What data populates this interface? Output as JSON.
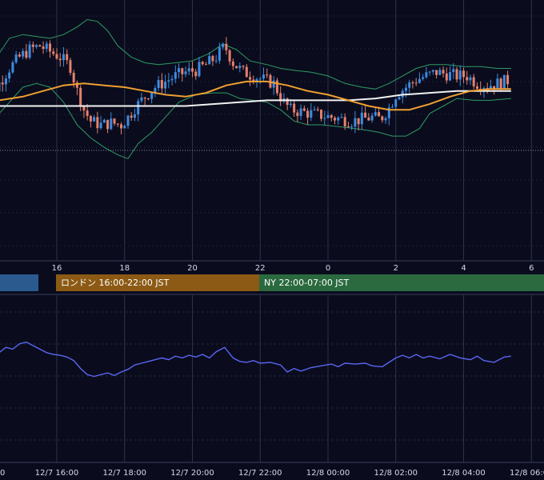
{
  "colors": {
    "background": "#0a0c1e",
    "grid": "#2e3248",
    "candle_up": "#3d8be0",
    "candle_down": "#e8806a",
    "bollinger": "#2f9b63",
    "ma_orange": "#f0a030",
    "ma_white": "#f2f2f2",
    "oscillator": "#5a66f0",
    "session_tokyo": "#2a5a8e",
    "session_london": "#8c5a14",
    "session_ny": "#2a6a3e"
  },
  "sessions": {
    "tokyo": {
      "label": ""
    },
    "london": {
      "label": "ロンドン 16:00-22:00 JST"
    },
    "ny": {
      "label": "NY 22:00-07:00 JST"
    }
  },
  "chart_data": [
    {
      "type": "candlestick",
      "name": "price",
      "x_ticks": [
        "16",
        "18",
        "20",
        "22",
        "0",
        "2",
        "4",
        "6"
      ],
      "x_range_hours": [
        13.7,
        29.4
      ],
      "y_range": [
        0,
        100
      ],
      "grid": true,
      "close_path": [
        [
          13.7,
          50
        ],
        [
          14.0,
          55
        ],
        [
          14.3,
          62
        ],
        [
          14.6,
          70
        ],
        [
          14.9,
          76
        ],
        [
          15.2,
          80
        ],
        [
          15.5,
          82
        ],
        [
          15.8,
          79
        ],
        [
          16.1,
          76
        ],
        [
          16.4,
          71
        ],
        [
          16.6,
          58
        ],
        [
          16.8,
          48
        ],
        [
          17.0,
          42
        ],
        [
          17.3,
          40
        ],
        [
          17.6,
          41
        ],
        [
          17.9,
          40
        ],
        [
          18.1,
          44
        ],
        [
          18.3,
          49
        ],
        [
          18.6,
          55
        ],
        [
          18.9,
          60
        ],
        [
          19.2,
          63
        ],
        [
          19.5,
          66
        ],
        [
          19.8,
          68
        ],
        [
          20.1,
          69
        ],
        [
          20.4,
          72
        ],
        [
          20.7,
          76
        ],
        [
          20.95,
          82
        ],
        [
          21.2,
          73
        ],
        [
          21.5,
          68
        ],
        [
          21.8,
          66
        ],
        [
          22.1,
          64
        ],
        [
          22.4,
          62
        ],
        [
          22.65,
          53
        ],
        [
          22.9,
          48
        ],
        [
          23.2,
          47
        ],
        [
          23.5,
          46
        ],
        [
          23.8,
          45
        ],
        [
          24.1,
          44
        ],
        [
          24.4,
          43
        ],
        [
          24.7,
          42
        ],
        [
          25.0,
          43
        ],
        [
          25.3,
          44
        ],
        [
          25.55,
          43
        ],
        [
          25.8,
          49
        ],
        [
          26.0,
          56
        ],
        [
          26.3,
          60
        ],
        [
          26.6,
          64
        ],
        [
          26.9,
          66
        ],
        [
          27.2,
          68
        ],
        [
          27.5,
          67
        ],
        [
          27.8,
          66
        ],
        [
          28.1,
          66
        ],
        [
          28.4,
          62
        ],
        [
          28.7,
          61
        ],
        [
          29.0,
          62
        ],
        [
          29.4,
          64
        ]
      ],
      "bollinger_upper_path": [
        [
          13.7,
          60
        ],
        [
          14.0,
          68
        ],
        [
          14.3,
          78
        ],
        [
          14.6,
          86
        ],
        [
          15.0,
          88
        ],
        [
          15.4,
          87
        ],
        [
          15.8,
          86
        ],
        [
          16.2,
          88
        ],
        [
          16.6,
          92
        ],
        [
          16.9,
          96
        ],
        [
          17.2,
          95
        ],
        [
          17.5,
          90
        ],
        [
          17.8,
          82
        ],
        [
          18.2,
          76
        ],
        [
          18.6,
          73
        ],
        [
          19.0,
          72
        ],
        [
          19.5,
          73
        ],
        [
          20.0,
          74
        ],
        [
          20.5,
          78
        ],
        [
          20.9,
          83
        ],
        [
          21.3,
          80
        ],
        [
          21.7,
          74
        ],
        [
          22.2,
          72
        ],
        [
          22.6,
          70
        ],
        [
          23.0,
          69
        ],
        [
          23.5,
          68
        ],
        [
          24.0,
          66
        ],
        [
          24.5,
          62
        ],
        [
          25.0,
          60
        ],
        [
          25.4,
          59
        ],
        [
          25.8,
          62
        ],
        [
          26.2,
          66
        ],
        [
          26.6,
          70
        ],
        [
          27.0,
          72
        ],
        [
          27.5,
          72
        ],
        [
          28.0,
          71
        ],
        [
          28.5,
          71
        ],
        [
          29.0,
          70
        ],
        [
          29.4,
          70
        ]
      ],
      "bollinger_lower_path": [
        [
          13.7,
          38
        ],
        [
          14.0,
          40
        ],
        [
          14.3,
          46
        ],
        [
          14.6,
          52
        ],
        [
          15.0,
          60
        ],
        [
          15.4,
          62
        ],
        [
          15.8,
          60
        ],
        [
          16.2,
          52
        ],
        [
          16.6,
          40
        ],
        [
          17.0,
          33
        ],
        [
          17.4,
          28
        ],
        [
          17.8,
          24
        ],
        [
          18.1,
          22
        ],
        [
          18.4,
          30
        ],
        [
          18.8,
          36
        ],
        [
          19.2,
          44
        ],
        [
          19.6,
          52
        ],
        [
          20.1,
          56
        ],
        [
          20.6,
          57
        ],
        [
          21.0,
          57
        ],
        [
          21.4,
          54
        ],
        [
          21.8,
          53
        ],
        [
          22.2,
          52
        ],
        [
          22.6,
          48
        ],
        [
          23.0,
          42
        ],
        [
          23.4,
          40
        ],
        [
          23.8,
          40
        ],
        [
          24.3,
          39
        ],
        [
          24.8,
          38
        ],
        [
          25.2,
          37
        ],
        [
          25.5,
          36
        ],
        [
          25.9,
          34
        ],
        [
          26.3,
          34
        ],
        [
          26.7,
          38
        ],
        [
          27.0,
          46
        ],
        [
          27.4,
          50
        ],
        [
          27.8,
          54
        ],
        [
          28.3,
          53
        ],
        [
          28.8,
          53
        ],
        [
          29.4,
          54
        ]
      ],
      "ma_orange_path": [
        [
          13.7,
          53
        ],
        [
          14.3,
          53
        ],
        [
          15.0,
          55
        ],
        [
          15.6,
          58
        ],
        [
          16.2,
          61
        ],
        [
          16.8,
          62
        ],
        [
          17.4,
          61
        ],
        [
          18.0,
          60
        ],
        [
          18.6,
          58
        ],
        [
          19.2,
          56
        ],
        [
          19.8,
          55
        ],
        [
          20.4,
          57
        ],
        [
          21.0,
          61
        ],
        [
          21.6,
          63
        ],
        [
          22.2,
          63
        ],
        [
          22.8,
          61
        ],
        [
          23.4,
          58
        ],
        [
          24.0,
          56
        ],
        [
          24.6,
          53
        ],
        [
          25.2,
          50
        ],
        [
          25.8,
          48
        ],
        [
          26.4,
          48
        ],
        [
          27.0,
          51
        ],
        [
          27.6,
          55
        ],
        [
          28.2,
          58
        ],
        [
          28.8,
          59
        ],
        [
          29.4,
          59
        ]
      ],
      "ma_white_path": [
        [
          13.7,
          50
        ],
        [
          14.3,
          50
        ],
        [
          15.0,
          50
        ],
        [
          15.8,
          50
        ],
        [
          16.6,
          50
        ],
        [
          17.4,
          50
        ],
        [
          18.2,
          50
        ],
        [
          19.0,
          50
        ],
        [
          19.8,
          50
        ],
        [
          20.6,
          51
        ],
        [
          21.4,
          52
        ],
        [
          22.2,
          53
        ],
        [
          23.0,
          53
        ],
        [
          23.8,
          53
        ],
        [
          24.6,
          53
        ],
        [
          25.4,
          54
        ],
        [
          26.2,
          56
        ],
        [
          27.0,
          57
        ],
        [
          27.8,
          58
        ],
        [
          28.6,
          58
        ],
        [
          29.4,
          58
        ]
      ]
    },
    {
      "type": "line",
      "name": "oscillator",
      "x_ticks": [
        "12/7 16:00",
        "12/7 18:00",
        "12/7 20:00",
        "12/7 22:00",
        "12/8 00:00",
        "12/8 02:00",
        "12/8 04:00",
        "12/8 06:00"
      ],
      "x_range_hours": [
        13.7,
        29.4
      ],
      "y_range": [
        0,
        100
      ],
      "grid": true,
      "values": [
        [
          13.7,
          62
        ],
        [
          14.0,
          66
        ],
        [
          14.3,
          72
        ],
        [
          14.5,
          78
        ],
        [
          14.7,
          76
        ],
        [
          14.9,
          82
        ],
        [
          15.1,
          84
        ],
        [
          15.3,
          80
        ],
        [
          15.5,
          76
        ],
        [
          15.7,
          72
        ],
        [
          15.9,
          70
        ],
        [
          16.1,
          69
        ],
        [
          16.3,
          67
        ],
        [
          16.5,
          63
        ],
        [
          16.7,
          54
        ],
        [
          16.9,
          47
        ],
        [
          17.1,
          45
        ],
        [
          17.3,
          47
        ],
        [
          17.5,
          49
        ],
        [
          17.7,
          46
        ],
        [
          17.9,
          50
        ],
        [
          18.1,
          53
        ],
        [
          18.3,
          58
        ],
        [
          18.5,
          60
        ],
        [
          18.7,
          62
        ],
        [
          18.9,
          64
        ],
        [
          19.1,
          66
        ],
        [
          19.3,
          64
        ],
        [
          19.5,
          68
        ],
        [
          19.7,
          66
        ],
        [
          19.9,
          69
        ],
        [
          20.1,
          67
        ],
        [
          20.3,
          70
        ],
        [
          20.5,
          66
        ],
        [
          20.7,
          73
        ],
        [
          20.95,
          78
        ],
        [
          21.2,
          66
        ],
        [
          21.4,
          62
        ],
        [
          21.6,
          61
        ],
        [
          21.8,
          63
        ],
        [
          22.0,
          60
        ],
        [
          22.3,
          61
        ],
        [
          22.6,
          58
        ],
        [
          22.8,
          50
        ],
        [
          23.0,
          54
        ],
        [
          23.2,
          51
        ],
        [
          23.5,
          55
        ],
        [
          23.8,
          57
        ],
        [
          24.1,
          59
        ],
        [
          24.3,
          56
        ],
        [
          24.5,
          60
        ],
        [
          24.8,
          59
        ],
        [
          25.1,
          60
        ],
        [
          25.3,
          57
        ],
        [
          25.6,
          56
        ],
        [
          25.8,
          61
        ],
        [
          26.0,
          66
        ],
        [
          26.2,
          69
        ],
        [
          26.4,
          66
        ],
        [
          26.6,
          70
        ],
        [
          26.8,
          66
        ],
        [
          27.0,
          68
        ],
        [
          27.3,
          65
        ],
        [
          27.6,
          70
        ],
        [
          27.9,
          66
        ],
        [
          28.2,
          64
        ],
        [
          28.4,
          68
        ],
        [
          28.6,
          63
        ],
        [
          28.9,
          61
        ],
        [
          29.2,
          67
        ],
        [
          29.4,
          68
        ]
      ]
    }
  ]
}
